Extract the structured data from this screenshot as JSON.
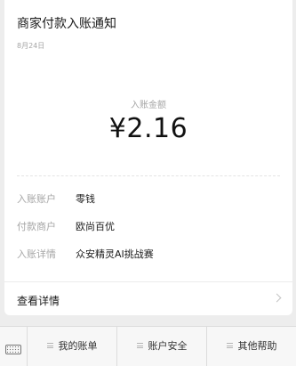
{
  "notice": {
    "title": "商家付款入账通知",
    "date": "8月24日",
    "amount_label": "入账金额",
    "amount": "¥2.16"
  },
  "details": [
    {
      "key": "入账账户",
      "value": "零钱"
    },
    {
      "key": "付款商户",
      "value": "欧尚百优"
    },
    {
      "key": "入账详情",
      "value": "众安精灵AI挑战赛"
    }
  ],
  "view_details": {
    "label": "查看详情"
  },
  "menu": {
    "items": [
      {
        "label": "我的账单",
        "icon": "menu-lines-icon"
      },
      {
        "label": "账户安全",
        "icon": "menu-lines-icon"
      },
      {
        "label": "其他帮助",
        "icon": "menu-lines-icon"
      }
    ],
    "keyboard_icon": "keyboard-icon"
  }
}
